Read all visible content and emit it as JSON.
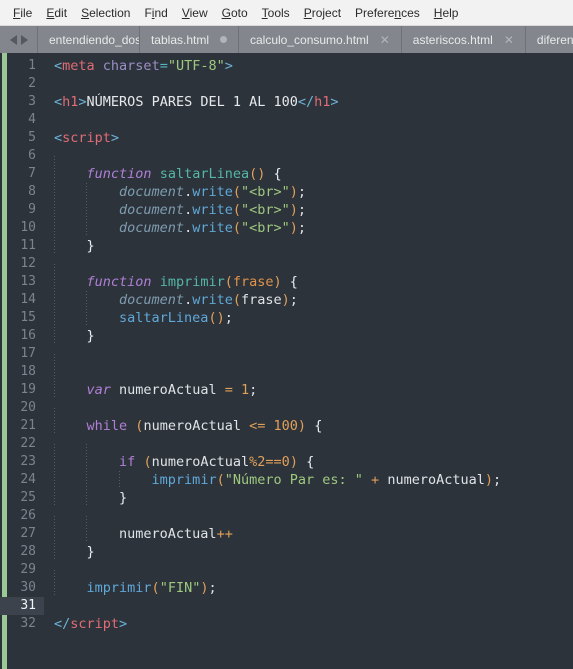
{
  "window": {
    "app": "Sublime Text",
    "theme_accent": "#9bc995",
    "editor_background": "#2d333b",
    "tabbar_background": "#83868c",
    "menubar_background": "#f2f2f2"
  },
  "menubar": {
    "items": [
      {
        "label": "File",
        "accel": "F"
      },
      {
        "label": "Edit",
        "accel": "E"
      },
      {
        "label": "Selection",
        "accel": "S"
      },
      {
        "label": "Find",
        "accel": "i"
      },
      {
        "label": "View",
        "accel": "V"
      },
      {
        "label": "Goto",
        "accel": "G"
      },
      {
        "label": "Tools",
        "accel": "T"
      },
      {
        "label": "Project",
        "accel": "P"
      },
      {
        "label": "Preferences",
        "accel": "n"
      },
      {
        "label": "Help",
        "accel": "H"
      }
    ]
  },
  "tabbar": {
    "nav_prev_icon": "arrow-left-icon",
    "nav_next_icon": "arrow-right-icon",
    "tabs": [
      {
        "label": "entendiendo_dos_mu",
        "indicator": "none",
        "clipped": true
      },
      {
        "label": "tablas.html",
        "indicator": "dirty",
        "clipped": false
      },
      {
        "label": "calculo_consumo.html",
        "indicator": "close",
        "clipped": false
      },
      {
        "label": "asteriscos.html",
        "indicator": "close",
        "clipped": false
      },
      {
        "label": "diferen",
        "indicator": "none",
        "clipped": true
      }
    ]
  },
  "editor": {
    "active_line": 31,
    "total_lines": 32,
    "language": "HTML",
    "lines": [
      {
        "n": 1,
        "indent": 0,
        "tokens": [
          {
            "t": "<",
            "c": "t-punct"
          },
          {
            "t": "meta",
            "c": "t-tag"
          },
          {
            "t": " ",
            "c": "t-plain"
          },
          {
            "t": "charset",
            "c": "t-attr"
          },
          {
            "t": "=",
            "c": "t-op"
          },
          {
            "t": "\"UTF-8\"",
            "c": "t-str"
          },
          {
            "t": ">",
            "c": "t-punct"
          }
        ]
      },
      {
        "n": 2,
        "indent": 0,
        "tokens": []
      },
      {
        "n": 3,
        "indent": 0,
        "tokens": [
          {
            "t": "<",
            "c": "t-punct"
          },
          {
            "t": "h1",
            "c": "t-tag"
          },
          {
            "t": ">",
            "c": "t-punct"
          },
          {
            "t": "NÚMEROS PARES DEL 1 AL 100",
            "c": "t-text"
          },
          {
            "t": "</",
            "c": "t-punct"
          },
          {
            "t": "h1",
            "c": "t-tag"
          },
          {
            "t": ">",
            "c": "t-punct"
          }
        ]
      },
      {
        "n": 4,
        "indent": 0,
        "tokens": []
      },
      {
        "n": 5,
        "indent": 0,
        "tokens": [
          {
            "t": "<",
            "c": "t-punct"
          },
          {
            "t": "script",
            "c": "t-tag"
          },
          {
            "t": ">",
            "c": "t-punct"
          }
        ]
      },
      {
        "n": 6,
        "indent": 1,
        "tokens": []
      },
      {
        "n": 7,
        "indent": 1,
        "tokens": [
          {
            "t": "    ",
            "c": "t-plain"
          },
          {
            "t": "function",
            "c": "t-kw"
          },
          {
            "t": " ",
            "c": "t-plain"
          },
          {
            "t": "saltarLinea",
            "c": "t-fn"
          },
          {
            "t": "()",
            "c": "t-paren"
          },
          {
            "t": " ",
            "c": "t-plain"
          },
          {
            "t": "{",
            "c": "t-brace"
          }
        ]
      },
      {
        "n": 8,
        "indent": 2,
        "tokens": [
          {
            "t": "        ",
            "c": "t-plain"
          },
          {
            "t": "document",
            "c": "t-obj"
          },
          {
            "t": ".",
            "c": "t-plain"
          },
          {
            "t": "write",
            "c": "t-prop"
          },
          {
            "t": "(",
            "c": "t-paren"
          },
          {
            "t": "\"<br>\"",
            "c": "t-str"
          },
          {
            "t": ")",
            "c": "t-paren"
          },
          {
            "t": ";",
            "c": "t-plain"
          }
        ]
      },
      {
        "n": 9,
        "indent": 2,
        "tokens": [
          {
            "t": "        ",
            "c": "t-plain"
          },
          {
            "t": "document",
            "c": "t-obj"
          },
          {
            "t": ".",
            "c": "t-plain"
          },
          {
            "t": "write",
            "c": "t-prop"
          },
          {
            "t": "(",
            "c": "t-paren"
          },
          {
            "t": "\"<br>\"",
            "c": "t-str"
          },
          {
            "t": ")",
            "c": "t-paren"
          },
          {
            "t": ";",
            "c": "t-plain"
          }
        ]
      },
      {
        "n": 10,
        "indent": 2,
        "tokens": [
          {
            "t": "        ",
            "c": "t-plain"
          },
          {
            "t": "document",
            "c": "t-obj"
          },
          {
            "t": ".",
            "c": "t-plain"
          },
          {
            "t": "write",
            "c": "t-prop"
          },
          {
            "t": "(",
            "c": "t-paren"
          },
          {
            "t": "\"<br>\"",
            "c": "t-str"
          },
          {
            "t": ")",
            "c": "t-paren"
          },
          {
            "t": ";",
            "c": "t-plain"
          }
        ]
      },
      {
        "n": 11,
        "indent": 1,
        "tokens": [
          {
            "t": "    ",
            "c": "t-plain"
          },
          {
            "t": "}",
            "c": "t-brace"
          }
        ]
      },
      {
        "n": 12,
        "indent": 1,
        "tokens": []
      },
      {
        "n": 13,
        "indent": 1,
        "tokens": [
          {
            "t": "    ",
            "c": "t-plain"
          },
          {
            "t": "function",
            "c": "t-kw"
          },
          {
            "t": " ",
            "c": "t-plain"
          },
          {
            "t": "imprimir",
            "c": "t-fn"
          },
          {
            "t": "(",
            "c": "t-paren"
          },
          {
            "t": "frase",
            "c": "t-param"
          },
          {
            "t": ")",
            "c": "t-paren"
          },
          {
            "t": " ",
            "c": "t-plain"
          },
          {
            "t": "{",
            "c": "t-brace"
          }
        ]
      },
      {
        "n": 14,
        "indent": 2,
        "tokens": [
          {
            "t": "        ",
            "c": "t-plain"
          },
          {
            "t": "document",
            "c": "t-obj"
          },
          {
            "t": ".",
            "c": "t-plain"
          },
          {
            "t": "write",
            "c": "t-prop"
          },
          {
            "t": "(",
            "c": "t-paren"
          },
          {
            "t": "frase",
            "c": "t-plain"
          },
          {
            "t": ")",
            "c": "t-paren"
          },
          {
            "t": ";",
            "c": "t-plain"
          }
        ]
      },
      {
        "n": 15,
        "indent": 2,
        "tokens": [
          {
            "t": "        ",
            "c": "t-plain"
          },
          {
            "t": "saltarLinea",
            "c": "t-call"
          },
          {
            "t": "()",
            "c": "t-paren"
          },
          {
            "t": ";",
            "c": "t-plain"
          }
        ]
      },
      {
        "n": 16,
        "indent": 1,
        "tokens": [
          {
            "t": "    ",
            "c": "t-plain"
          },
          {
            "t": "}",
            "c": "t-brace"
          }
        ]
      },
      {
        "n": 17,
        "indent": 1,
        "tokens": []
      },
      {
        "n": 18,
        "indent": 1,
        "tokens": []
      },
      {
        "n": 19,
        "indent": 1,
        "tokens": [
          {
            "t": "    ",
            "c": "t-plain"
          },
          {
            "t": "var",
            "c": "t-kw"
          },
          {
            "t": " ",
            "c": "t-plain"
          },
          {
            "t": "numeroActual",
            "c": "t-plain"
          },
          {
            "t": " ",
            "c": "t-plain"
          },
          {
            "t": "=",
            "c": "t-paren"
          },
          {
            "t": " ",
            "c": "t-plain"
          },
          {
            "t": "1",
            "c": "t-num"
          },
          {
            "t": ";",
            "c": "t-plain"
          }
        ]
      },
      {
        "n": 20,
        "indent": 1,
        "tokens": []
      },
      {
        "n": 21,
        "indent": 1,
        "tokens": [
          {
            "t": "    ",
            "c": "t-plain"
          },
          {
            "t": "while",
            "c": "t-kw2"
          },
          {
            "t": " ",
            "c": "t-plain"
          },
          {
            "t": "(",
            "c": "t-paren"
          },
          {
            "t": "numeroActual",
            "c": "t-plain"
          },
          {
            "t": " ",
            "c": "t-plain"
          },
          {
            "t": "<=",
            "c": "t-paren"
          },
          {
            "t": " ",
            "c": "t-plain"
          },
          {
            "t": "100",
            "c": "t-num"
          },
          {
            "t": ")",
            "c": "t-paren"
          },
          {
            "t": " ",
            "c": "t-plain"
          },
          {
            "t": "{",
            "c": "t-brace"
          }
        ]
      },
      {
        "n": 22,
        "indent": 2,
        "tokens": []
      },
      {
        "n": 23,
        "indent": 2,
        "tokens": [
          {
            "t": "        ",
            "c": "t-plain"
          },
          {
            "t": "if",
            "c": "t-kw2"
          },
          {
            "t": " ",
            "c": "t-plain"
          },
          {
            "t": "(",
            "c": "t-paren"
          },
          {
            "t": "numeroActual",
            "c": "t-plain"
          },
          {
            "t": "%",
            "c": "t-paren"
          },
          {
            "t": "2",
            "c": "t-num"
          },
          {
            "t": "==",
            "c": "t-paren"
          },
          {
            "t": "0",
            "c": "t-num"
          },
          {
            "t": ")",
            "c": "t-paren"
          },
          {
            "t": " ",
            "c": "t-plain"
          },
          {
            "t": "{",
            "c": "t-brace"
          }
        ]
      },
      {
        "n": 24,
        "indent": 3,
        "tokens": [
          {
            "t": "            ",
            "c": "t-plain"
          },
          {
            "t": "imprimir",
            "c": "t-call"
          },
          {
            "t": "(",
            "c": "t-paren"
          },
          {
            "t": "\"Número Par es: \"",
            "c": "t-str"
          },
          {
            "t": " ",
            "c": "t-plain"
          },
          {
            "t": "+",
            "c": "t-paren"
          },
          {
            "t": " ",
            "c": "t-plain"
          },
          {
            "t": "numeroActual",
            "c": "t-plain"
          },
          {
            "t": ")",
            "c": "t-paren"
          },
          {
            "t": ";",
            "c": "t-plain"
          }
        ]
      },
      {
        "n": 25,
        "indent": 2,
        "tokens": [
          {
            "t": "        ",
            "c": "t-plain"
          },
          {
            "t": "}",
            "c": "t-brace"
          }
        ]
      },
      {
        "n": 26,
        "indent": 2,
        "tokens": []
      },
      {
        "n": 27,
        "indent": 2,
        "tokens": [
          {
            "t": "        ",
            "c": "t-plain"
          },
          {
            "t": "numeroActual",
            "c": "t-plain"
          },
          {
            "t": "++",
            "c": "t-paren"
          }
        ]
      },
      {
        "n": 28,
        "indent": 1,
        "tokens": [
          {
            "t": "    ",
            "c": "t-plain"
          },
          {
            "t": "}",
            "c": "t-brace"
          }
        ]
      },
      {
        "n": 29,
        "indent": 1,
        "tokens": []
      },
      {
        "n": 30,
        "indent": 1,
        "tokens": [
          {
            "t": "    ",
            "c": "t-plain"
          },
          {
            "t": "imprimir",
            "c": "t-call"
          },
          {
            "t": "(",
            "c": "t-paren"
          },
          {
            "t": "\"FIN\"",
            "c": "t-str"
          },
          {
            "t": ")",
            "c": "t-paren"
          },
          {
            "t": ";",
            "c": "t-plain"
          }
        ]
      },
      {
        "n": 31,
        "indent": 0,
        "tokens": []
      },
      {
        "n": 32,
        "indent": 0,
        "tokens": [
          {
            "t": "</",
            "c": "t-punct"
          },
          {
            "t": "script",
            "c": "t-tag"
          },
          {
            "t": ">",
            "c": "t-punct"
          }
        ]
      }
    ]
  }
}
